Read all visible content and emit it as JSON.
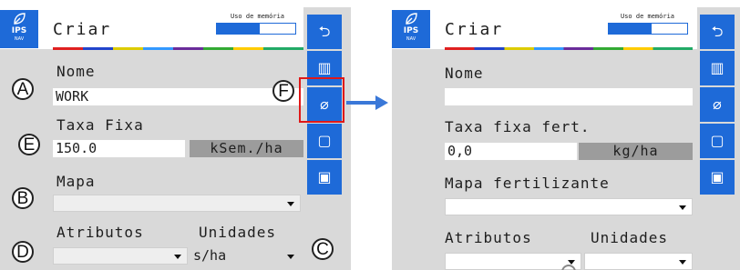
{
  "screen1": {
    "logo": {
      "line1": "IPS",
      "line2": "NAV"
    },
    "title": "Criar",
    "memory": {
      "label": "Uso de memória",
      "fill_fraction": 0.55
    },
    "fields": {
      "nome_label": "Nome",
      "nome_value": "WORK",
      "taxa_label": "Taxa Fixa",
      "taxa_value": "150.0",
      "taxa_unit": "kSem./ha",
      "mapa_label": "Mapa",
      "mapa_value": "",
      "atributos_label": "Atributos",
      "unidades_label": "Unidades",
      "atributos_value": "",
      "unidades_value": "s/ha"
    },
    "toolbar": [
      {
        "icon": "undo-icon",
        "glyph": "⮌"
      },
      {
        "icon": "map-icon",
        "glyph": "▥"
      },
      {
        "icon": "leaf-icon",
        "glyph": "⌀"
      },
      {
        "icon": "square-icon",
        "glyph": "▢"
      },
      {
        "icon": "save-icon",
        "glyph": "▣"
      }
    ]
  },
  "screen2": {
    "logo": {
      "line1": "IPS",
      "line2": "NAV"
    },
    "title": "Criar",
    "memory": {
      "label": "Uso de memória",
      "fill_fraction": 0.55
    },
    "fields": {
      "nome_label": "Nome",
      "nome_value": "",
      "taxa_label": "Taxa fixa fert.",
      "taxa_value": "0,0",
      "taxa_unit": "kg/ha",
      "mapa_label": "Mapa fertilizante",
      "mapa_value": "",
      "atributos_label": "Atributos",
      "unidades_label": "Unidades",
      "atributos_value": "",
      "unidades_value": ""
    }
  },
  "callouts": {
    "a": "A",
    "b": "B",
    "c": "C",
    "d": "D",
    "e": "E",
    "f": "F"
  },
  "colors": {
    "accent_blue": "#1e6ad8",
    "highlight_red": "#e01818",
    "arrow_blue": "#3a78d8"
  }
}
